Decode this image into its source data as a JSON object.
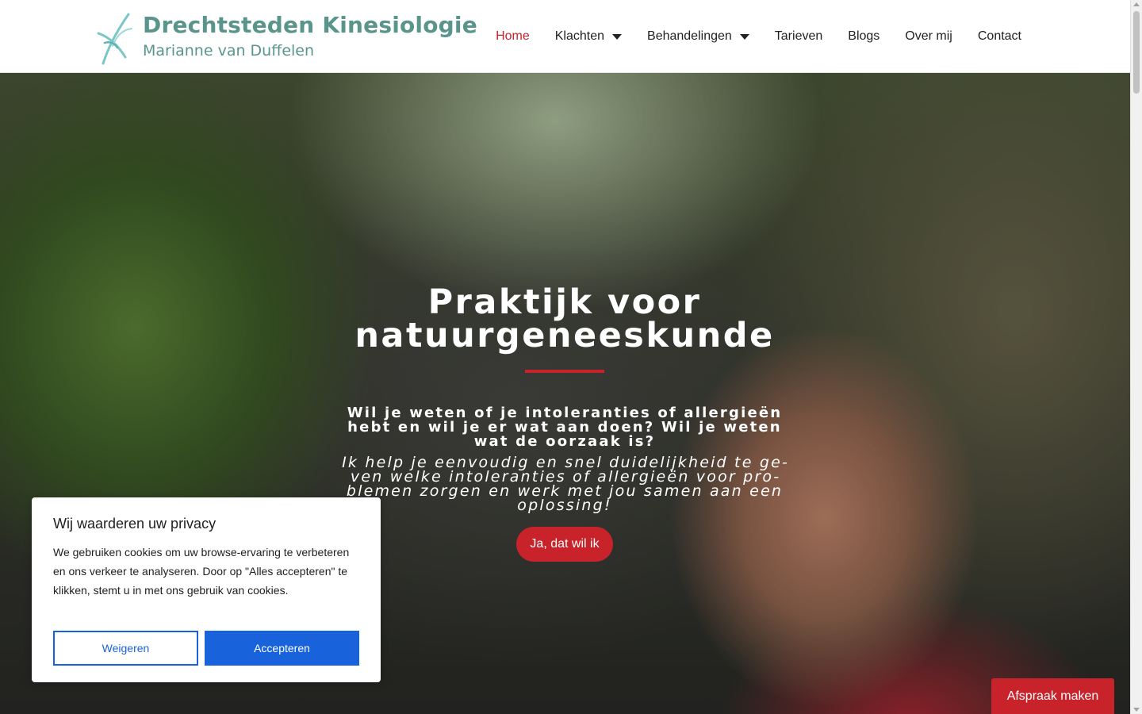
{
  "brand": {
    "title": "Drechtsteden Kinesiologie",
    "subtitle": "Marianne van Duffelen",
    "color": "#5a958c"
  },
  "nav": {
    "items": [
      {
        "label": "Home",
        "active": true,
        "has_dropdown": false
      },
      {
        "label": "Klachten",
        "active": false,
        "has_dropdown": true
      },
      {
        "label": "Behandelingen",
        "active": false,
        "has_dropdown": true
      },
      {
        "label": "Tarieven",
        "active": false,
        "has_dropdown": false
      },
      {
        "label": "Blogs",
        "active": false,
        "has_dropdown": false
      },
      {
        "label": "Over mij",
        "active": false,
        "has_dropdown": false
      },
      {
        "label": "Contact",
        "active": false,
        "has_dropdown": false
      }
    ],
    "active_color": "#c8222a"
  },
  "hero": {
    "title_line1": "Praktijk voor",
    "title_line2": "natuurgeneeskunde",
    "question": "Wil je weten of je intoleranties of allergieën hebt en wil je er wat aan doen? Wil je weten wat de oorzaak is?",
    "paragraph": "Ik help je eenvoudig en snel duidelijkheid te ge­ven welke intoleranties of allergieën voor pro­blemen zorgen en werk met jou samen aan een oplossing!",
    "cta_label": "Ja, dat wil ik",
    "accent_color": "#c8222a"
  },
  "cookie": {
    "title": "Wij waarderen uw privacy",
    "text": "We gebruiken cookies om uw browse-ervaring te verbeteren en ons verkeer te analyseren. Door op \"Alles accepteren\" te klikken, stemt u in met ons gebruik van cookies.",
    "reject_label": "Weigeren",
    "accept_label": "Accepteren",
    "button_color": "#1863dc"
  },
  "appointment": {
    "label": "Afspraak maken"
  }
}
